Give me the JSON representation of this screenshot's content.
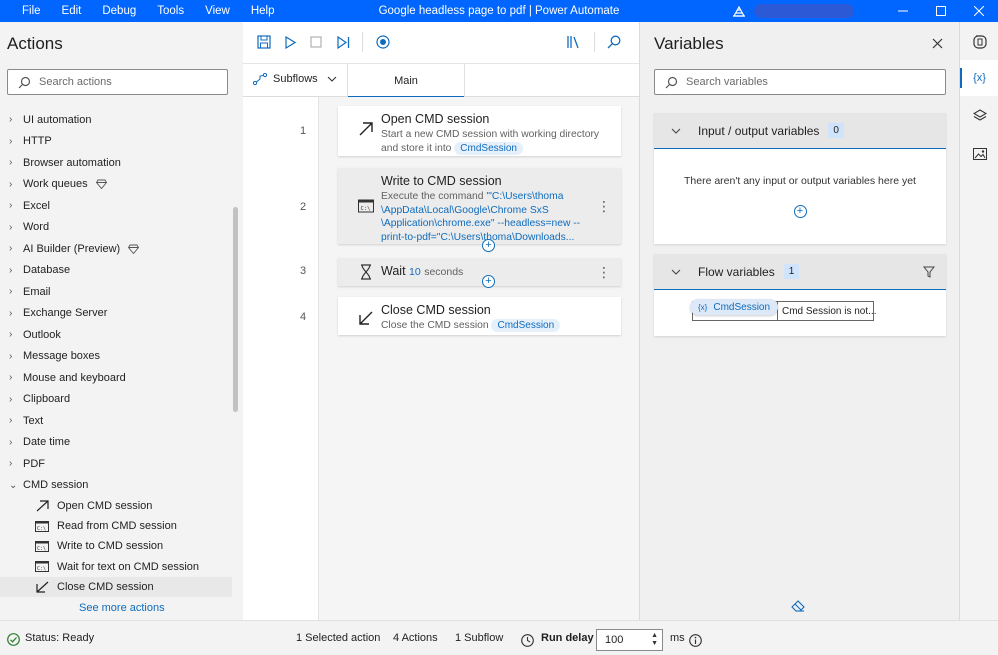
{
  "titlebar": {
    "menu": [
      "File",
      "Edit",
      "Debug",
      "Tools",
      "View",
      "Help"
    ],
    "title": "Google headless page to pdf | Power Automate"
  },
  "actions_panel": {
    "title": "Actions",
    "search_placeholder": "Search actions",
    "categories": [
      "UI automation",
      "HTTP",
      "Browser automation",
      "Work queues",
      "Excel",
      "Word",
      "AI Builder (Preview)",
      "Database",
      "Email",
      "Exchange Server",
      "Outlook",
      "Message boxes",
      "Mouse and keyboard",
      "Clipboard",
      "Text",
      "Date time",
      "PDF",
      "CMD session"
    ],
    "cmd_session_items": [
      "Open CMD session",
      "Read from CMD session",
      "Write to CMD session",
      "Wait for text on CMD session",
      "Close CMD session"
    ],
    "see_more": "See more actions"
  },
  "designer": {
    "subflows_label": "Subflows",
    "main_tab": "Main",
    "steps": [
      {
        "number": "1",
        "title": "Open CMD session",
        "desc": "Start a new CMD session with working directory and store it into",
        "var": "CmdSession"
      },
      {
        "number": "2",
        "title": "Write to CMD session",
        "desc_prefix": "Execute the command ",
        "command": "'\"C:\\Users\\thoma \\AppData\\Local\\Google\\Chrome SxS \\Application\\chrome.exe\" --headless=new -- print-to-pdf=\"C:\\Users\\thoma\\Downloads..."
      },
      {
        "number": "3",
        "title": "Wait",
        "value": "10",
        "unit": "seconds"
      },
      {
        "number": "4",
        "title": "Close CMD session",
        "desc": "Close the CMD session",
        "var": "CmdSession"
      }
    ]
  },
  "variables_panel": {
    "title": "Variables",
    "search_placeholder": "Search variables",
    "io_section": {
      "title": "Input / output variables",
      "count": "0",
      "empty_message": "There aren't any input or output variables here yet"
    },
    "flow_section": {
      "title": "Flow variables",
      "count": "1",
      "var_name": "CmdSession",
      "var_value": "Cmd Session is not..."
    }
  },
  "statusbar": {
    "status": "Status: Ready",
    "selected": "1 Selected action",
    "actions": "4 Actions",
    "subflow": "1 Subflow",
    "run_delay_label": "Run delay",
    "run_delay_value": "100",
    "unit": "ms"
  },
  "colors": {
    "titlebar": "#0066ff",
    "accent": "#0f6cbd",
    "status_ok": "#2e7d32"
  }
}
